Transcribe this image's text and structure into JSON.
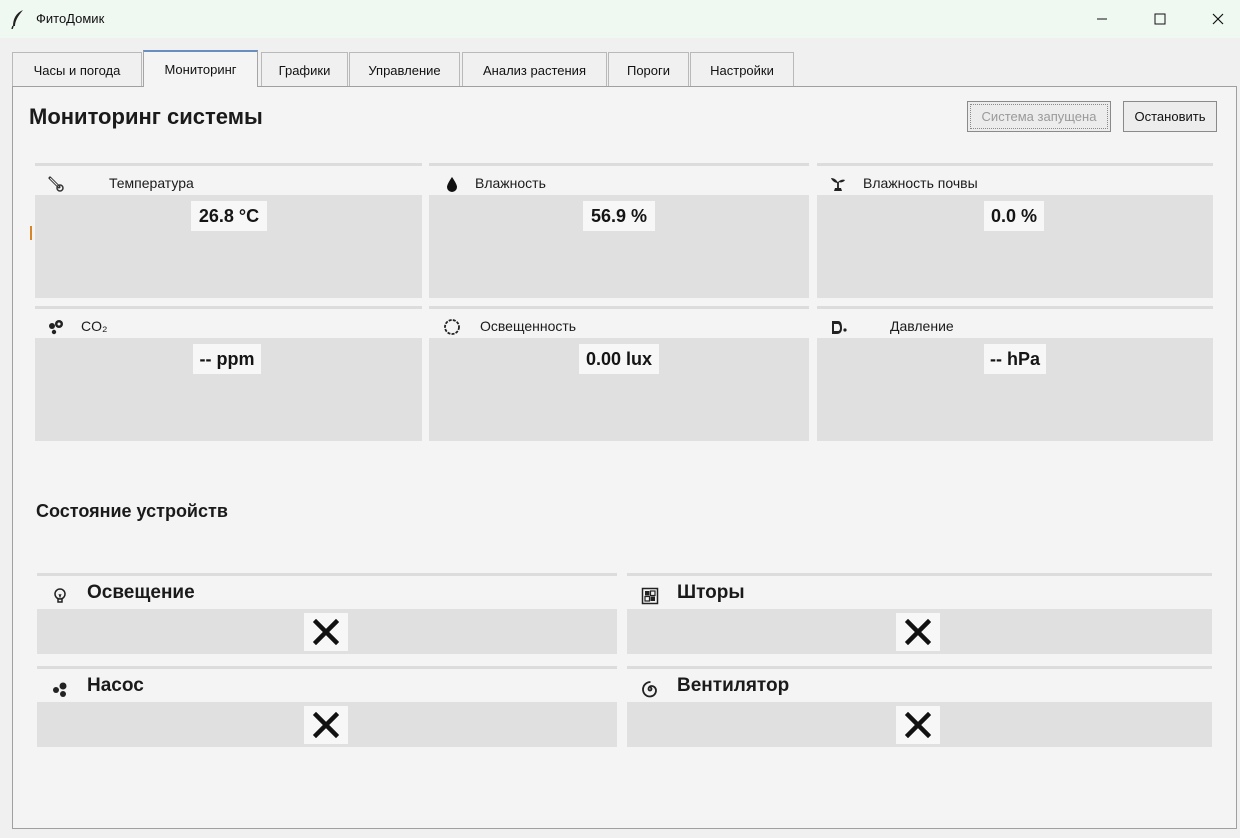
{
  "window": {
    "title": "ФитоДомик",
    "app_icon": "feather-icon",
    "controls": [
      "minimize-icon",
      "maximize-icon",
      "close-icon"
    ]
  },
  "tabs": [
    {
      "label": "Часы и погода",
      "active": false
    },
    {
      "label": "Мониторинг",
      "active": true
    },
    {
      "label": "Графики",
      "active": false
    },
    {
      "label": "Управление",
      "active": false
    },
    {
      "label": "Анализ растения",
      "active": false
    },
    {
      "label": "Пороги",
      "active": false
    },
    {
      "label": "Настройки",
      "active": false
    }
  ],
  "header": {
    "title": "Мониторинг системы",
    "status_button": "Система запущена",
    "stop_button": "Остановить"
  },
  "sensors": [
    {
      "label": "Температура",
      "value": "26.8 °C",
      "icon": "thermometer-icon"
    },
    {
      "label": "Влажность",
      "value": "56.9 %",
      "icon": "droplet-icon"
    },
    {
      "label": "Влажность почвы",
      "value": "0.0 %",
      "icon": "seedling-icon"
    },
    {
      "label": "CO₂",
      "value": "-- ppm",
      "icon": "molecule-icon"
    },
    {
      "label": "Освещенность",
      "value": "0.00 lux",
      "icon": "sun-icon"
    },
    {
      "label": "Давление",
      "value": "-- hPa",
      "icon": "gauge-icon"
    }
  ],
  "devices_section": {
    "title": "Состояние устройств",
    "devices": [
      {
        "label": "Освещение",
        "state": "✕",
        "icon": "bulb-icon"
      },
      {
        "label": "Шторы",
        "state": "✕",
        "icon": "curtains-icon"
      },
      {
        "label": "Насос",
        "state": "✕",
        "icon": "pump-icon"
      },
      {
        "label": "Вентилятор",
        "state": "✕",
        "icon": "fan-icon"
      }
    ]
  },
  "colors": {
    "tab_active_accent": "#6a8fbc",
    "card_fill": "#e0e0e0",
    "value_fill": "#f7f7f7",
    "marker": "#d7862a"
  }
}
